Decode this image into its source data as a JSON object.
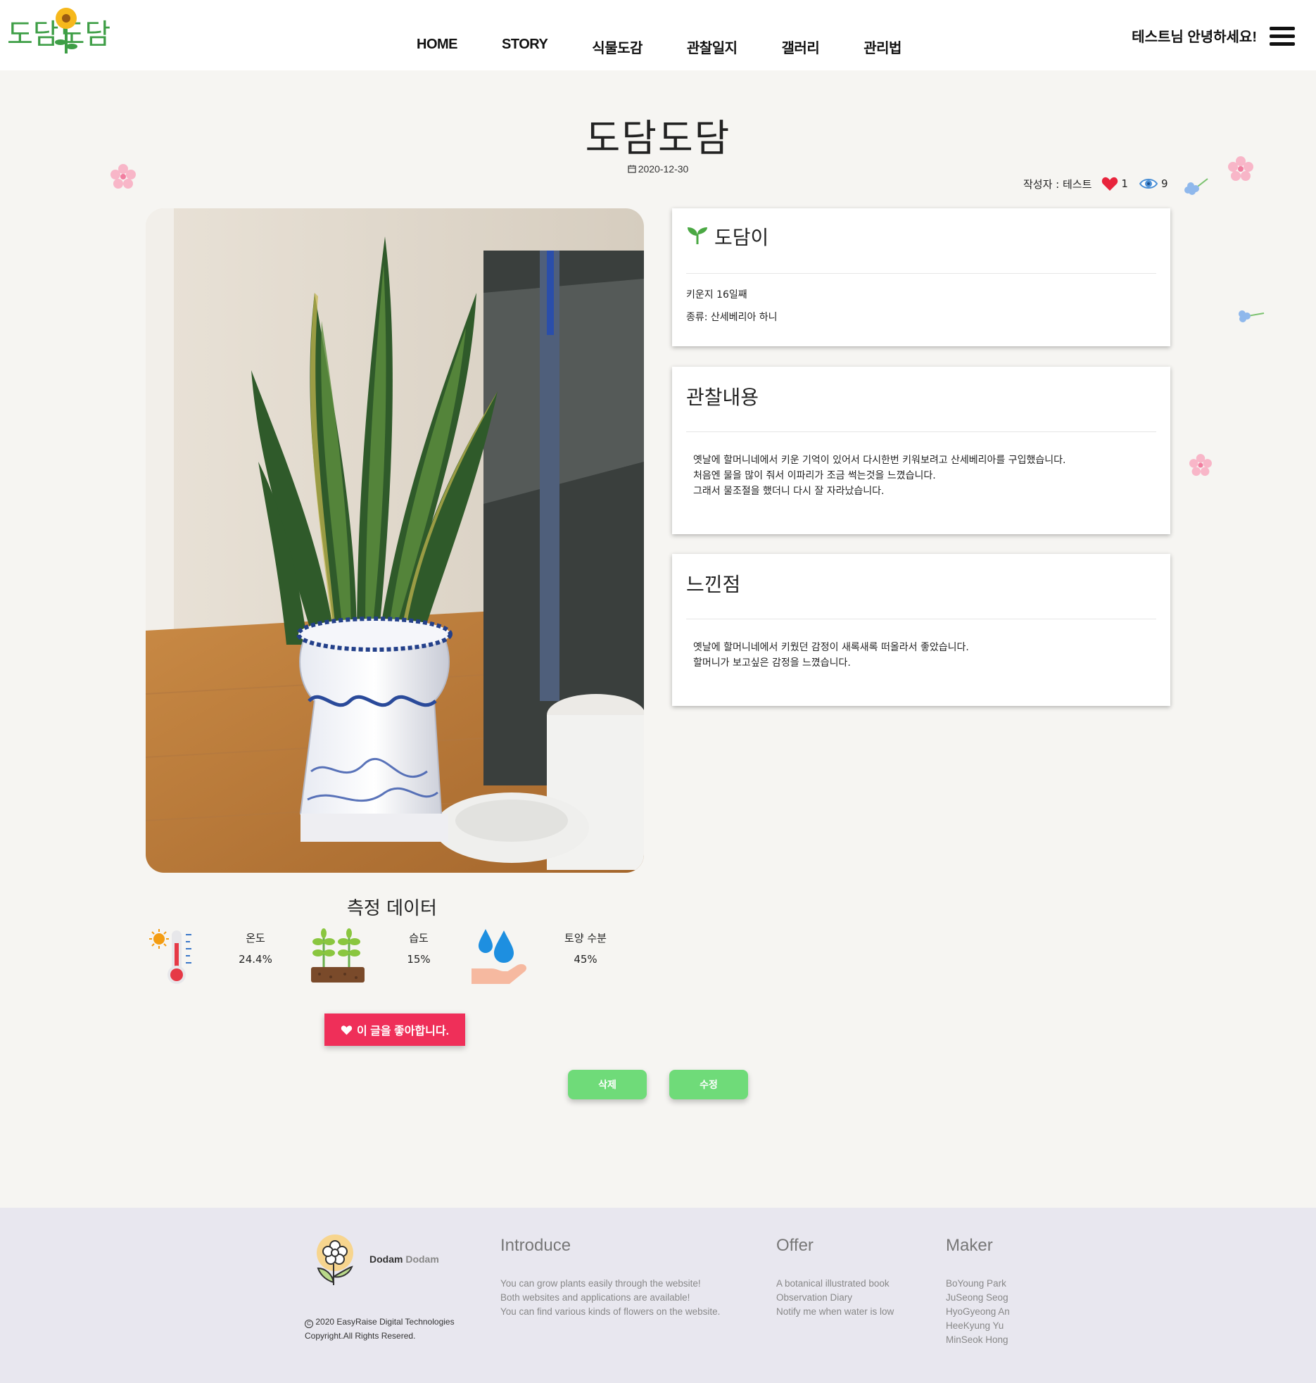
{
  "header": {
    "logo_text": "도담도담",
    "nav": [
      "HOME",
      "STORY",
      "식물도감",
      "관찰일지",
      "갤러리",
      "관리법"
    ],
    "greeting": "테스트님 안녕하세요!"
  },
  "post": {
    "title": "도담도담",
    "date": "2020-12-30",
    "author": "작성자 : 테스트",
    "likes": "1",
    "views": "9"
  },
  "plant_card": {
    "name": "도담이",
    "days": "키운지 16일째",
    "species": "종류: 산세베리아 하니"
  },
  "observation_card": {
    "title": "관찰내용",
    "lines": [
      "옛날에 할머니네에서 키운 기억이 있어서 다시한번 키워보려고 산세베리아를 구입했습니다.",
      "처음엔 물을 많이 줘서 이파리가 조금 썩는것을 느꼈습니다.",
      "그래서 물조절을 했더니 다시 잘 자라났습니다."
    ]
  },
  "feeling_card": {
    "title": "느낀점",
    "lines": [
      "옛날에 할머니네에서 키웠던 감정이 새록새록 떠올라서 좋았습니다.",
      "할머니가 보고싶은 감정을 느꼈습니다."
    ]
  },
  "measurements": {
    "title": "측정 데이터",
    "items": [
      {
        "label": "온도",
        "value": "24.4%",
        "icon": "thermometer-icon"
      },
      {
        "label": "습도",
        "value": "15%",
        "icon": "sprout-icon"
      },
      {
        "label": "토양 수분",
        "value": "45%",
        "icon": "water-drop-hand-icon"
      }
    ]
  },
  "buttons": {
    "like": "이 글을 좋아합니다.",
    "delete": "삭제",
    "edit": "수정"
  },
  "footer": {
    "brand_1": "Dodam",
    "brand_2": "Dodam",
    "copyright_1": "2020 EasyRaise Digital Technologies",
    "copyright_2": "Copyright.All Rights Resered.",
    "introduce": {
      "title": "Introduce",
      "lines": [
        "You can grow plants easily through the website!",
        "Both websites and applications are available!",
        "You can find various kinds of flowers on the website."
      ]
    },
    "offer": {
      "title": "Offer",
      "lines": [
        "A botanical illustrated book",
        "Observation Diary",
        "Notify me when water is low"
      ]
    },
    "maker": {
      "title": "Maker",
      "lines": [
        "BoYoung Park",
        "JuSeong Seog",
        "HyoGyeong An",
        "HeeKyung Yu",
        "MinSeok Hong"
      ]
    }
  },
  "colors": {
    "background": "#f6f5f2",
    "like_button": "#ef2f59",
    "action_button": "#6fdb79",
    "footer_bg": "#e8e7ef",
    "logo_green": "#3e9e46"
  }
}
